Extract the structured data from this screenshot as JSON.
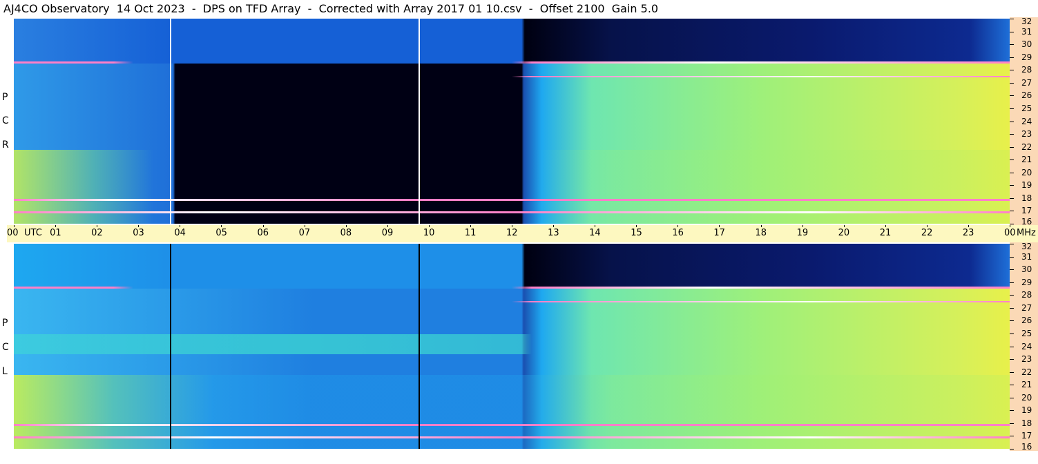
{
  "title": "AJ4CO Observatory  14 Oct 2023  -  DPS on TFD Array  -  Corrected with Array 2017 01 10.csv  -  Offset 2100  Gain 5.0",
  "chart_data": {
    "type": "heatmap",
    "title": "AJ4CO Observatory  14 Oct 2023  -  DPS on TFD Array  -  Corrected with Array 2017 01 10.csv  -  Offset 2100  Gain 5.0",
    "x_unit": "UTC",
    "y_unit": "MHz",
    "xlim": [
      0,
      24
    ],
    "ylim": [
      16,
      32
    ],
    "panels": [
      {
        "name": "RCP",
        "side_label": [
          "R",
          "C",
          "P"
        ]
      },
      {
        "name": "LCP",
        "side_label": [
          "L",
          "C",
          "P"
        ]
      }
    ]
  },
  "time_axis": {
    "labels": [
      "00",
      "UTC",
      "01",
      "02",
      "03",
      "04",
      "05",
      "06",
      "07",
      "08",
      "09",
      "10",
      "11",
      "12",
      "13",
      "14",
      "15",
      "16",
      "17",
      "18",
      "19",
      "20",
      "21",
      "22",
      "23",
      "00",
      "MHz"
    ]
  },
  "freq_axis": {
    "labels": [
      "32",
      "31",
      "30",
      "29",
      "28",
      "27",
      "26",
      "25",
      "24",
      "23",
      "22",
      "21",
      "20",
      "19",
      "18",
      "17",
      "16"
    ]
  },
  "colors": {
    "axis_right_bg": "#fbd9b6",
    "time_axis_bg": "#fdf8c0",
    "palette": [
      "#000010",
      "#0a1a6e",
      "#1560d6",
      "#1ea8f0",
      "#40e0d0",
      "#9ef07a",
      "#e8f04a",
      "#ff7fc8",
      "#ffffff"
    ]
  }
}
